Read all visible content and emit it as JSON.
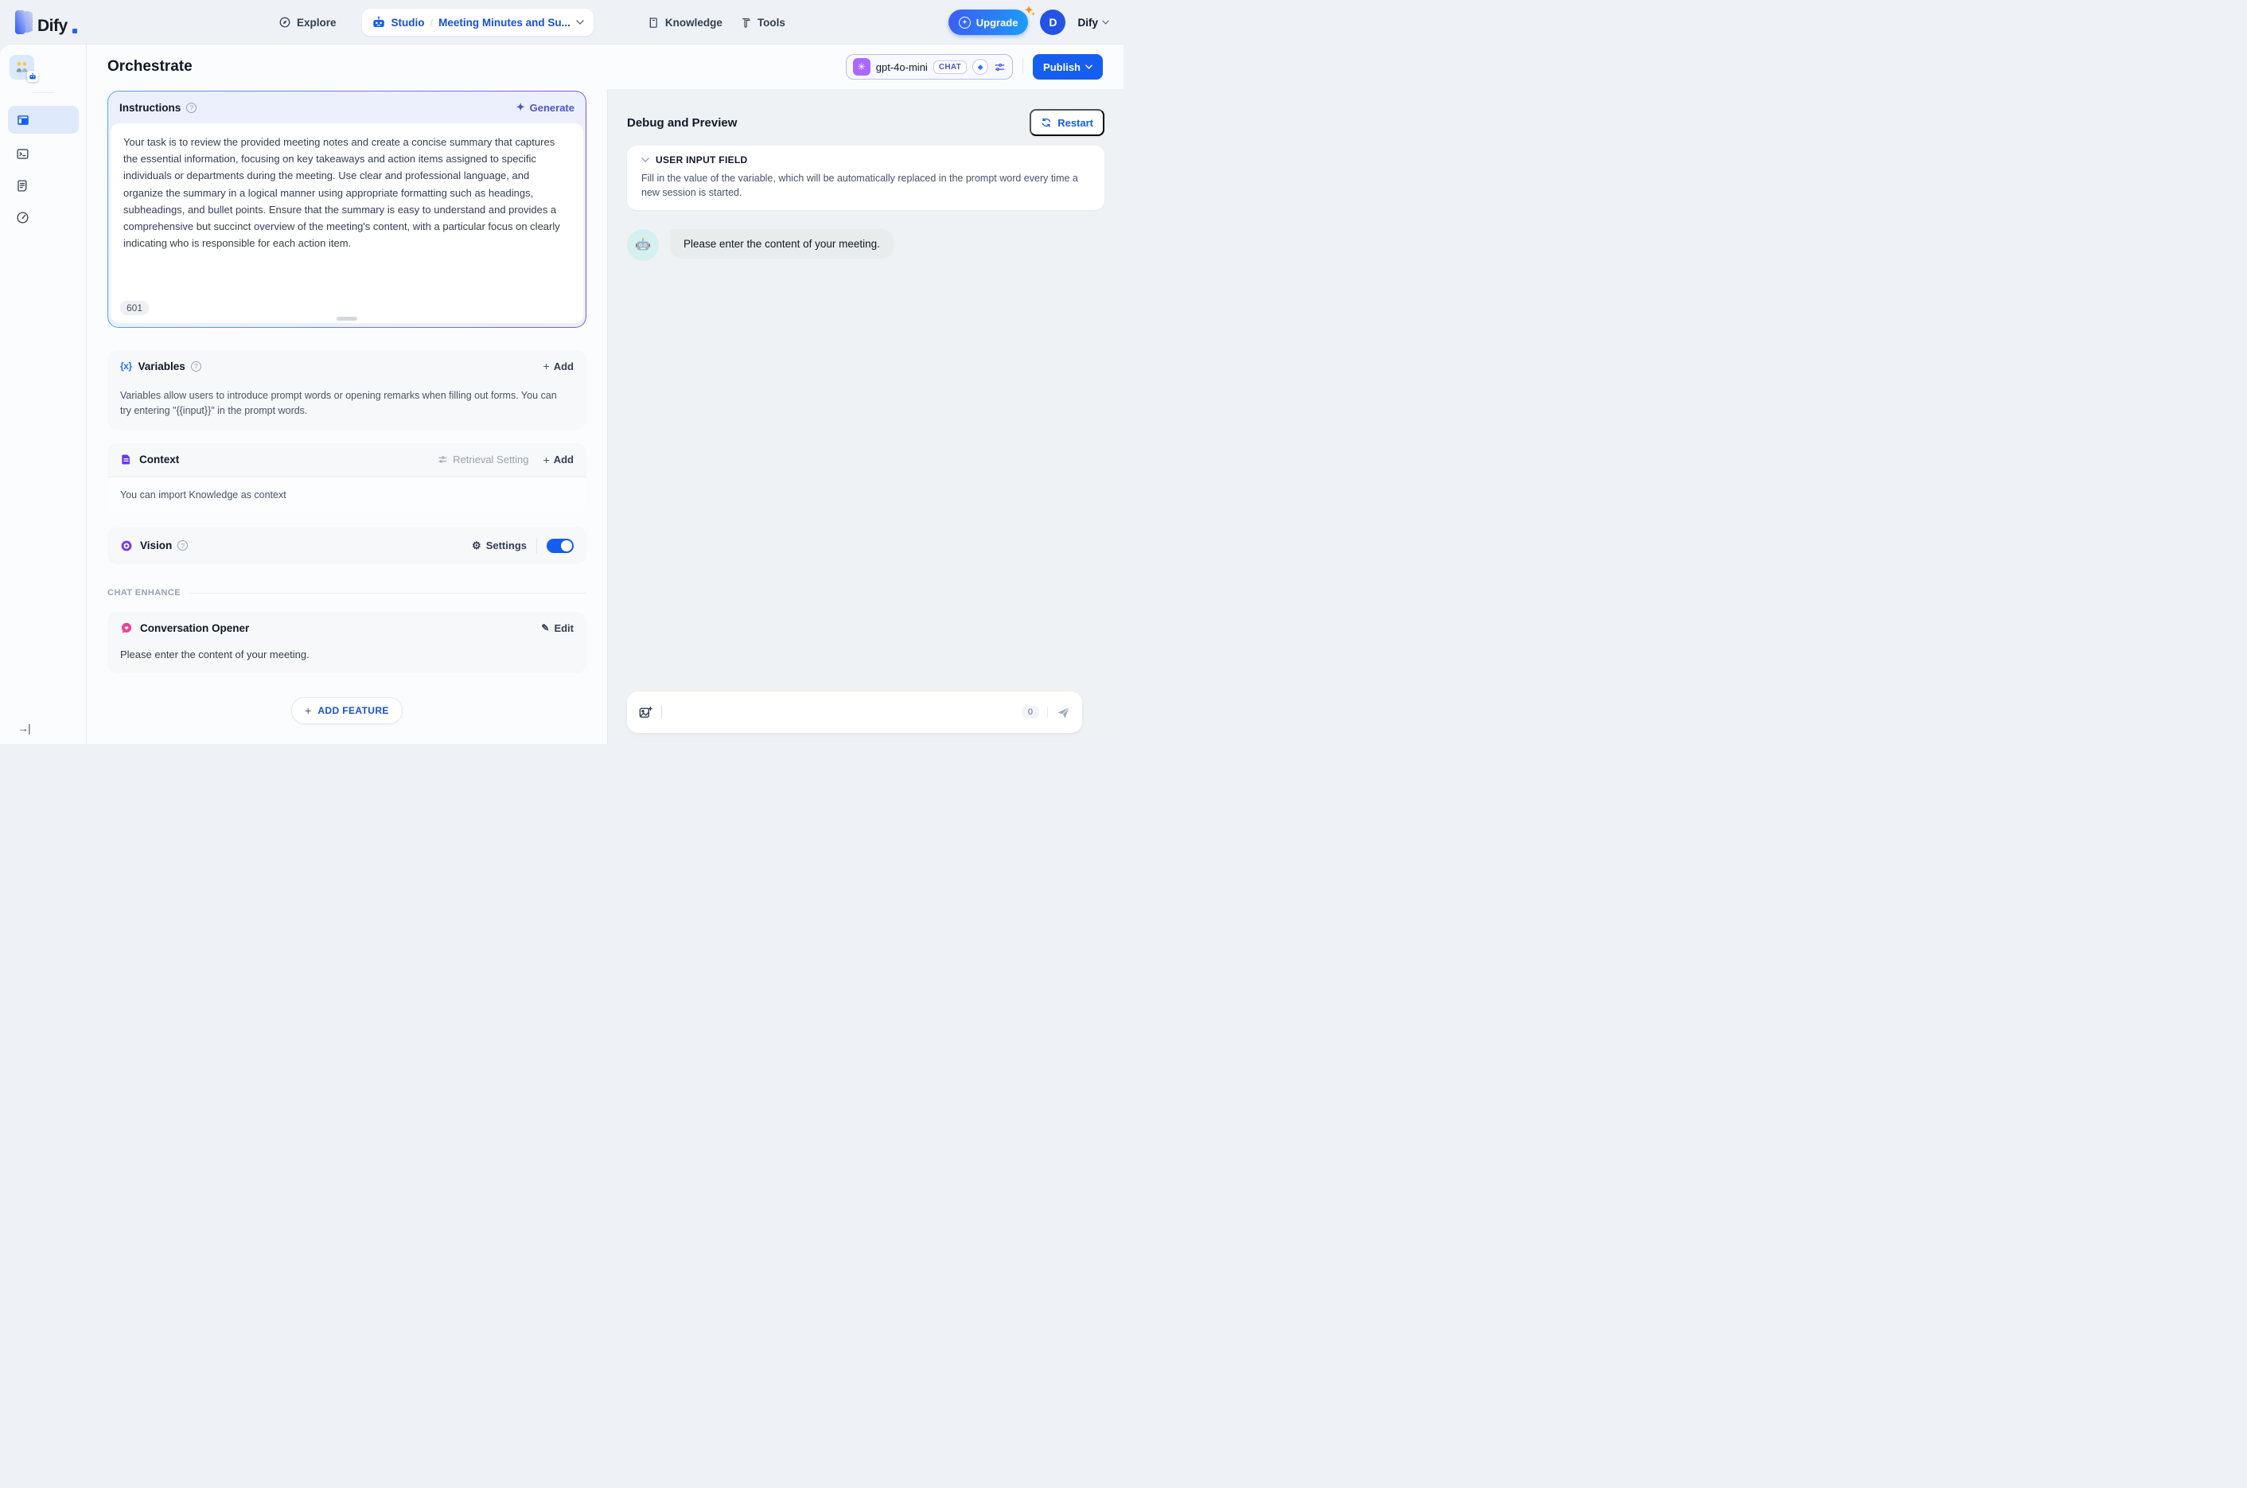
{
  "header": {
    "logo_text": "Dify",
    "nav": {
      "explore": "Explore",
      "studio": "Studio",
      "app_name": "Meeting Minutes and Su...",
      "knowledge": "Knowledge",
      "tools": "Tools"
    },
    "upgrade_label": "Upgrade",
    "avatar_initial": "D",
    "account_name": "Dify"
  },
  "topbar": {
    "title": "Orchestrate",
    "model": {
      "name": "gpt-4o-mini",
      "badge": "CHAT"
    },
    "publish_label": "Publish"
  },
  "orchestrate": {
    "instructions": {
      "title": "Instructions",
      "generate_label": "Generate",
      "text": "Your task is to review the provided meeting notes and create a concise summary that captures the essential information, focusing on key takeaways and action items assigned to specific individuals or departments during the meeting. Use clear and professional language, and organize the summary in a logical manner using appropriate formatting such as headings, subheadings, and bullet points. Ensure that the summary is easy to understand and provides a comprehensive but succinct overview of the meeting's content, with a particular focus on clearly indicating who is responsible for each action item.",
      "char_count": "601"
    },
    "variables": {
      "title": "Variables",
      "add_label": "Add",
      "description": "Variables allow users to introduce prompt words or opening remarks when filling out forms. You can try entering \"{{input}}\" in the prompt words."
    },
    "context": {
      "title": "Context",
      "retrieval_setting_label": "Retrieval Setting",
      "add_label": "Add",
      "empty_text": "You can import Knowledge as context"
    },
    "vision": {
      "title": "Vision",
      "settings_label": "Settings",
      "enabled": true
    },
    "chat_enhance_label": "CHAT ENHANCE",
    "conversation_opener": {
      "title": "Conversation Opener",
      "edit_label": "Edit",
      "text": "Please enter the content of your meeting."
    },
    "add_feature_label": "ADD FEATURE"
  },
  "debug": {
    "title": "Debug and Preview",
    "restart_label": "Restart",
    "user_input_field": {
      "title": "USER INPUT FIELD",
      "description": "Fill in the value of the variable, which will be automatically replaced in the prompt word every time a new session is started."
    },
    "bot_message": "Please enter the content of your meeting.",
    "composer": {
      "char_count": "0"
    }
  },
  "icons": {
    "plus": "+",
    "sparkle": "✦",
    "gem": "✦",
    "question": "?",
    "brace_x": "{x}",
    "openai": "✳",
    "gear": "⚙",
    "edit": "✎",
    "collapse": "→|"
  },
  "colors": {
    "primary_blue": "#155eef",
    "indigo": "#444ce7",
    "context_purple": "#6938ef",
    "vision_purple": "#7839ee",
    "opener_pink": "#e74694",
    "openai_purple": "#ab68ff"
  }
}
